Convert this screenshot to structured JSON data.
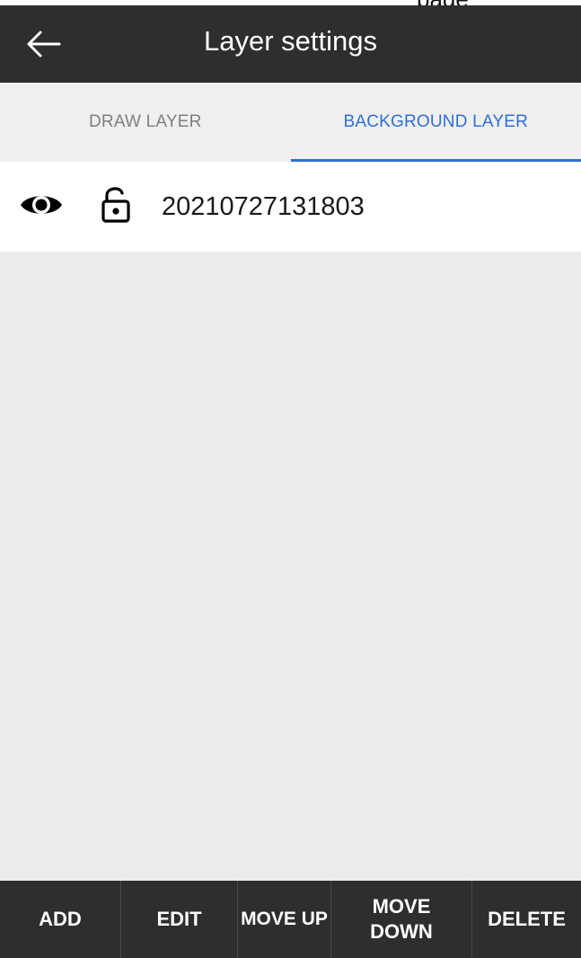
{
  "top_strip": {
    "text": "page"
  },
  "app_bar": {
    "title": "Layer settings",
    "back_icon": "arrow-left-icon"
  },
  "tabs": [
    {
      "label": "DRAW LAYER",
      "active": false
    },
    {
      "label": "BACKGROUND LAYER",
      "active": true
    }
  ],
  "layers": [
    {
      "name": "20210727131803",
      "visibility_icon": "eye-icon",
      "lock_icon": "unlock-icon"
    }
  ],
  "bottom_bar": {
    "add": "ADD",
    "edit": "EDIT",
    "move_up": "MOVE UP",
    "move_down": "MOVE\nDOWN",
    "delete": "DELETE"
  },
  "colors": {
    "app_bar": "#2e2e2e",
    "accent": "#2f6fd1",
    "background": "#ececec",
    "inactive_tab": "#7f7f7f"
  }
}
